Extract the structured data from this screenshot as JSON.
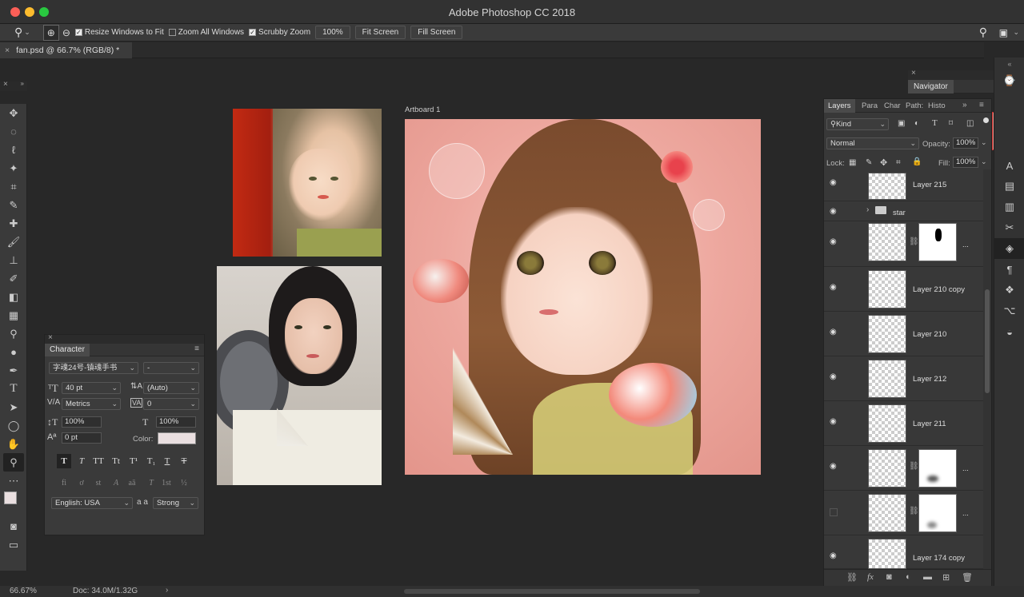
{
  "window": {
    "title": "Adobe Photoshop CC 2018"
  },
  "options": {
    "resize_windows": "Resize Windows to Fit",
    "zoom_all": "Zoom All Windows",
    "scrubby": "Scrubby Zoom",
    "zoom_value": "100%",
    "fit_screen": "Fit Screen",
    "fill_screen": "Fill Screen"
  },
  "document": {
    "tab_label": "fan.psd @ 66.7% (RGB/8) *",
    "artboard_label": "Artboard 1"
  },
  "status": {
    "zoom": "66.67%",
    "doc": "Doc: 34.0M/1.32G"
  },
  "character": {
    "title": "Character",
    "font_family": "字魂24号-镇魂手书",
    "font_style": "-",
    "size": "40 pt",
    "leading": "(Auto)",
    "kerning": "Metrics",
    "tracking": "0",
    "vscale": "100%",
    "hscale": "100%",
    "baseline": "0 pt",
    "color_label": "Color:",
    "language": "English: USA",
    "aa_label": "a a",
    "antialias": "Strong",
    "type_buttons": [
      "T",
      "T",
      "TT",
      "Tt",
      "T¹",
      "T₁",
      "T",
      "T"
    ],
    "ot_buttons": [
      "fi",
      "ơ",
      "st",
      "A",
      "aā",
      "T",
      "1st",
      "½"
    ]
  },
  "navigator": {
    "title": "Navigator"
  },
  "layers": {
    "tabs": [
      "Layers",
      "Para",
      "Char",
      "Path:",
      "Histo"
    ],
    "kind": "Kind",
    "blend": "Normal",
    "opacity_label": "Opacity:",
    "opacity": "100%",
    "lock_label": "Lock:",
    "fill_label": "Fill:",
    "fill": "100%",
    "rows": [
      {
        "name": "Layer 215"
      },
      {
        "name": "star"
      },
      {
        "name": "..."
      },
      {
        "name": "Layer 210 copy"
      },
      {
        "name": "Layer 210"
      },
      {
        "name": "Layer 212"
      },
      {
        "name": "Layer 211"
      },
      {
        "name": "..."
      },
      {
        "name": "..."
      },
      {
        "name": "Layer 174 copy"
      }
    ],
    "bottom_icons": [
      "link-icon",
      "fx-icon",
      "mask-icon",
      "adjustment-icon",
      "folder-icon",
      "new-layer-icon",
      "trash-icon"
    ]
  },
  "colors": {
    "accent": "#d29e8f",
    "bg": "#282828",
    "panel": "#383838"
  }
}
